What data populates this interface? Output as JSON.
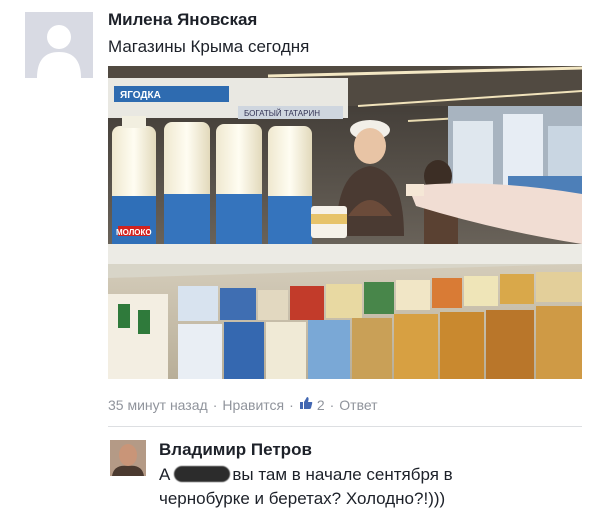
{
  "post": {
    "author": "Милена Яновская",
    "text": "Магазины Крыма сегодня",
    "photo": {
      "signs": [
        "ЯГОДКА",
        "БОГАТЫЙ ТАТАРИН"
      ],
      "bottle_label": "МОЛОКО"
    },
    "meta": {
      "time": "35 минут назад",
      "like": "Нравится",
      "like_count": "2",
      "reply": "Ответ"
    }
  },
  "comment": {
    "author": "Владимир Петров",
    "line1_prefix": "А",
    "line1_suffix": "вы там в начале сентября в",
    "line2": "чернобурке и беретах? Холодно?!)))"
  },
  "colors": {
    "text": "#1d2129",
    "meta": "#90949c",
    "link": "#4267b2",
    "divider": "#dddfe2"
  },
  "icons": {
    "post_avatar": "default-avatar-icon",
    "like": "thumbs-up-icon"
  }
}
